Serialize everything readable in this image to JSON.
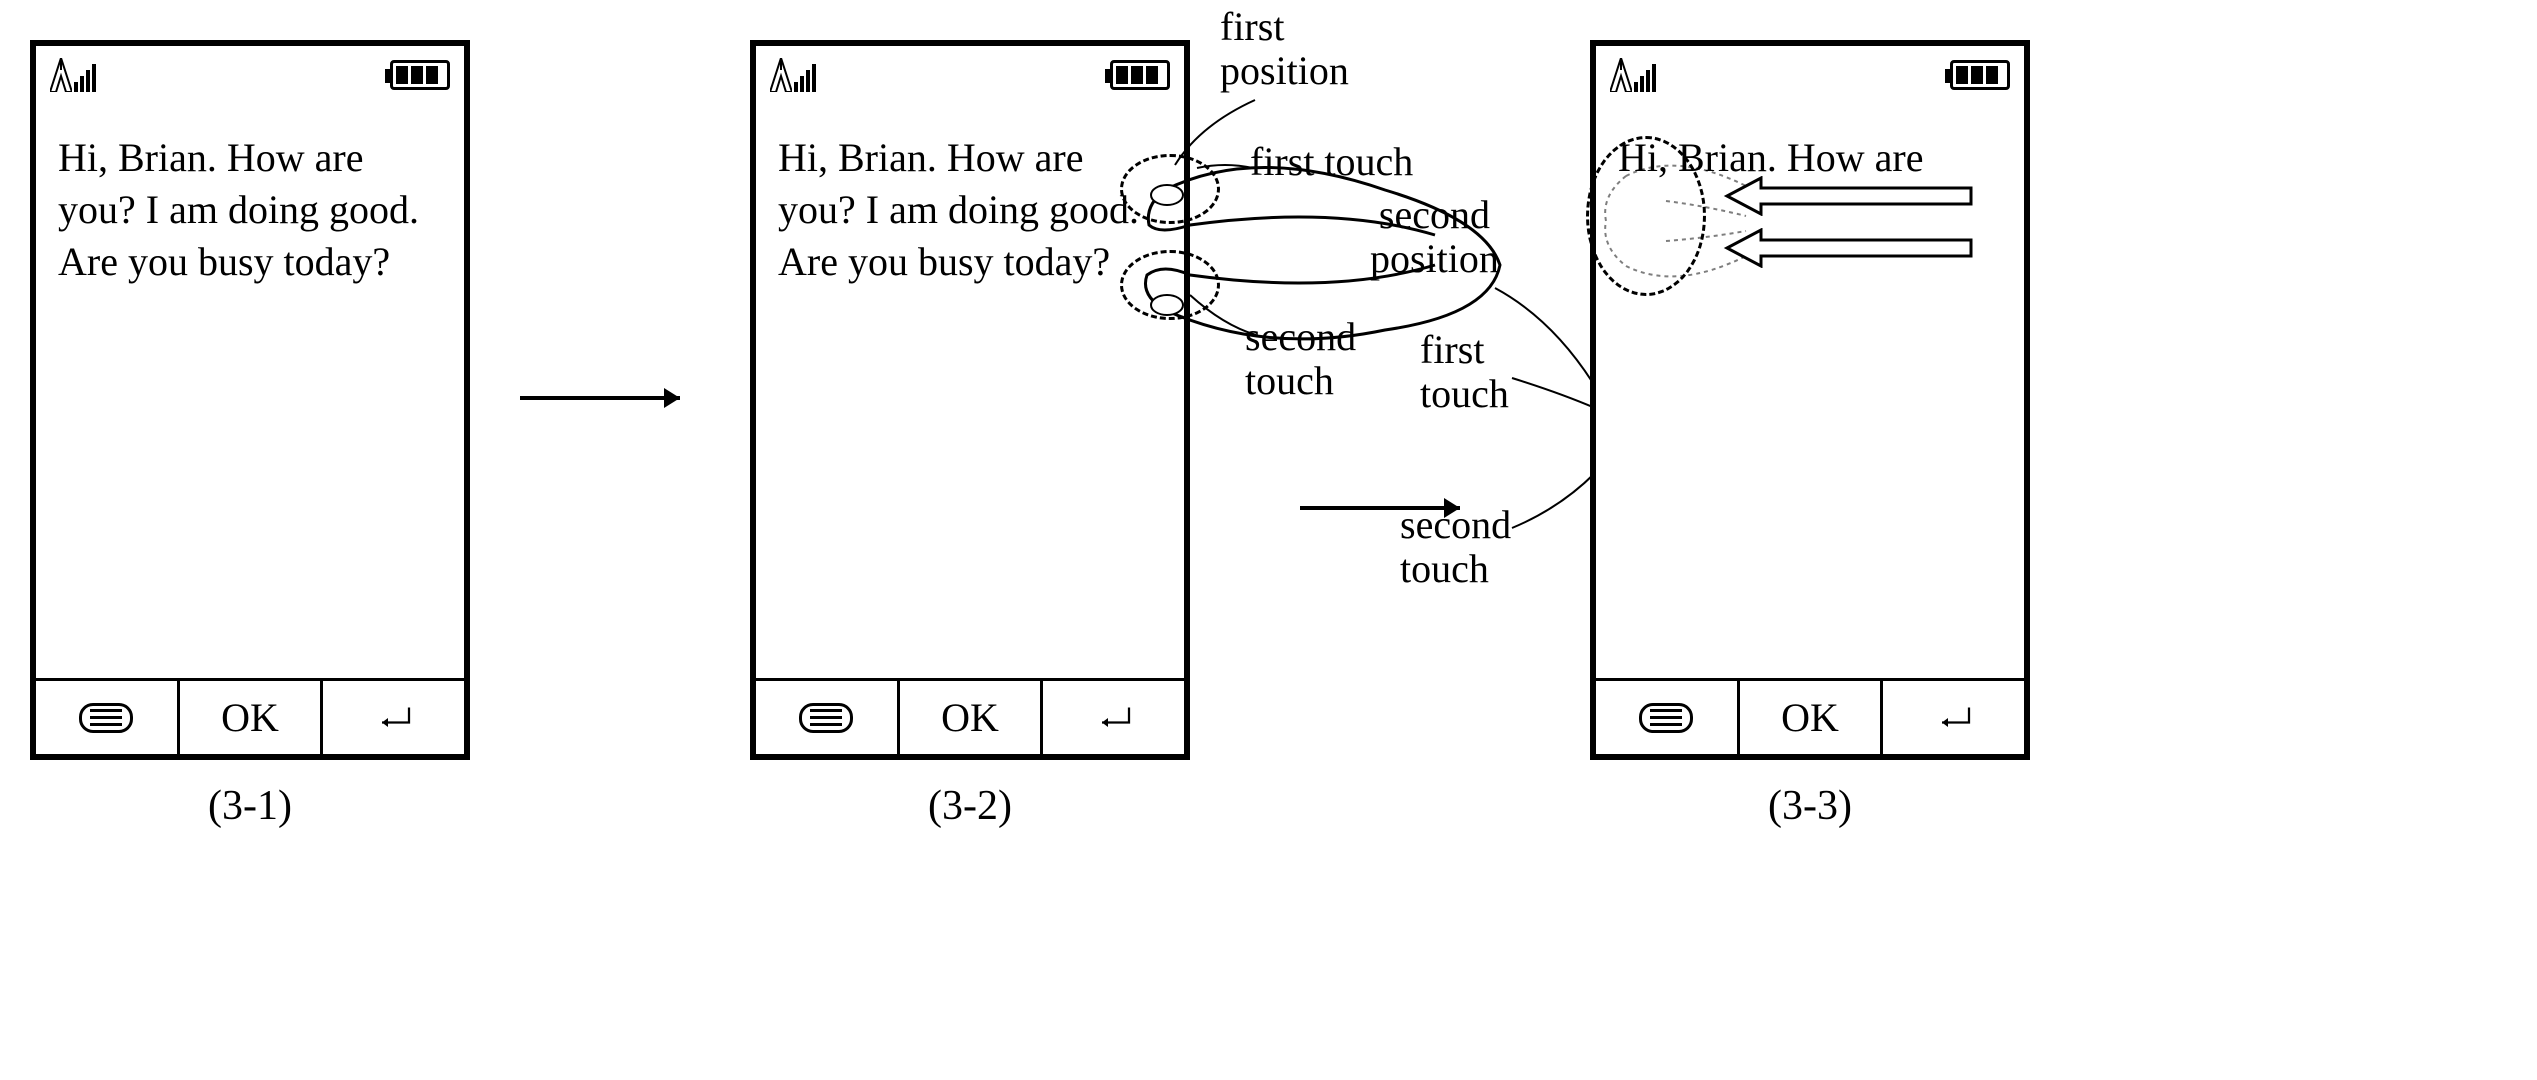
{
  "phones": {
    "p1": {
      "text": "Hi, Brian. How are you? I am doing good. Are you busy today?",
      "ok": "OK",
      "label": "(3-1)"
    },
    "p2": {
      "text": "Hi, Brian. How are you? I am doing good. Are you busy today?",
      "ok": "OK",
      "label": "(3-2)"
    },
    "p3": {
      "text": "Hi, Brian. How are",
      "ok": "OK",
      "label": "(3-3)"
    }
  },
  "annotations": {
    "first_position": "first\nposition",
    "second_position": "second\nposition",
    "first_touch_a": "first touch",
    "second_touch_a": "second\ntouch",
    "first_touch_b": "first\ntouch",
    "second_touch_b": "second\ntouch"
  },
  "icons": {
    "signal": "signal-icon",
    "battery": "battery-icon",
    "menu": "menu-icon",
    "enter": "enter-icon",
    "flow_arrow": "flow-arrow-icon",
    "swipe_arrow": "swipe-arrow-icon",
    "hand": "hand-gesture-icon",
    "touch_point": "touch-point-oval"
  }
}
